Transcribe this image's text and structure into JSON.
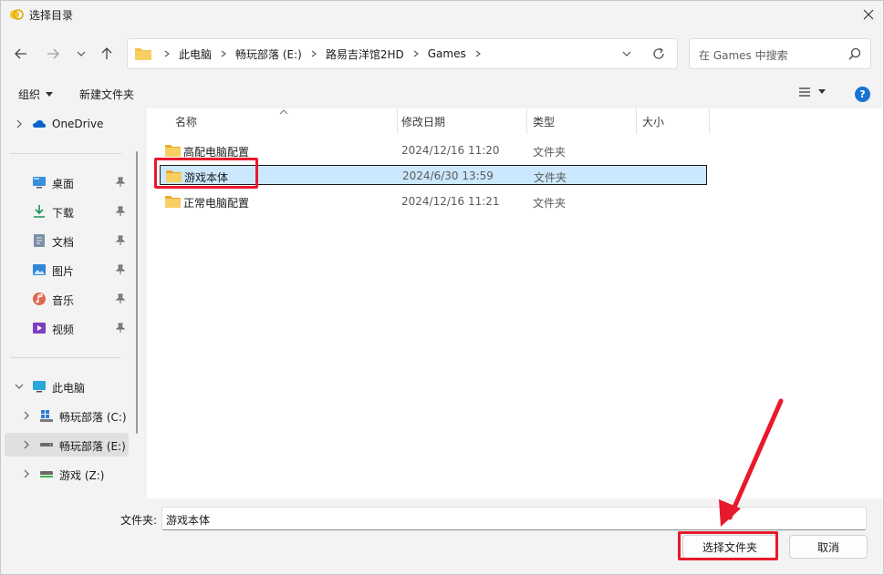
{
  "window": {
    "title": "选择目录"
  },
  "address": {
    "crumbs": [
      "此电脑",
      "畅玩部落 (E:)",
      "路易吉洋馆2HD",
      "Games"
    ]
  },
  "search": {
    "placeholder": "在 Games 中搜索"
  },
  "toolbar": {
    "organize_label": "组织",
    "new_folder_label": "新建文件夹",
    "help_label": "?"
  },
  "nav": {
    "onedrive": "OneDrive",
    "quick": [
      "桌面",
      "下载",
      "文档",
      "图片",
      "音乐",
      "视频"
    ],
    "this_pc": "此电脑",
    "drives": [
      "畅玩部落 (C:)",
      "畅玩部落 (E:)",
      "游戏 (Z:)"
    ]
  },
  "columns": {
    "name": "名称",
    "date": "修改日期",
    "type": "类型",
    "size": "大小"
  },
  "files": [
    {
      "name": "高配电脑配置",
      "date": "2024/12/16 11:20",
      "type": "文件夹"
    },
    {
      "name": "游戏本体",
      "date": "2024/6/30 13:59",
      "type": "文件夹"
    },
    {
      "name": "正常电脑配置",
      "date": "2024/12/16 11:21",
      "type": "文件夹"
    }
  ],
  "footer": {
    "folder_label": "文件夹:",
    "folder_value": "游戏本体",
    "select_button": "选择文件夹",
    "cancel_button": "取消"
  },
  "colors": {
    "accent": "#1a73d0",
    "selection": "#cce8ff",
    "annotation": "#e8192c",
    "folder": "#f5c04a"
  }
}
